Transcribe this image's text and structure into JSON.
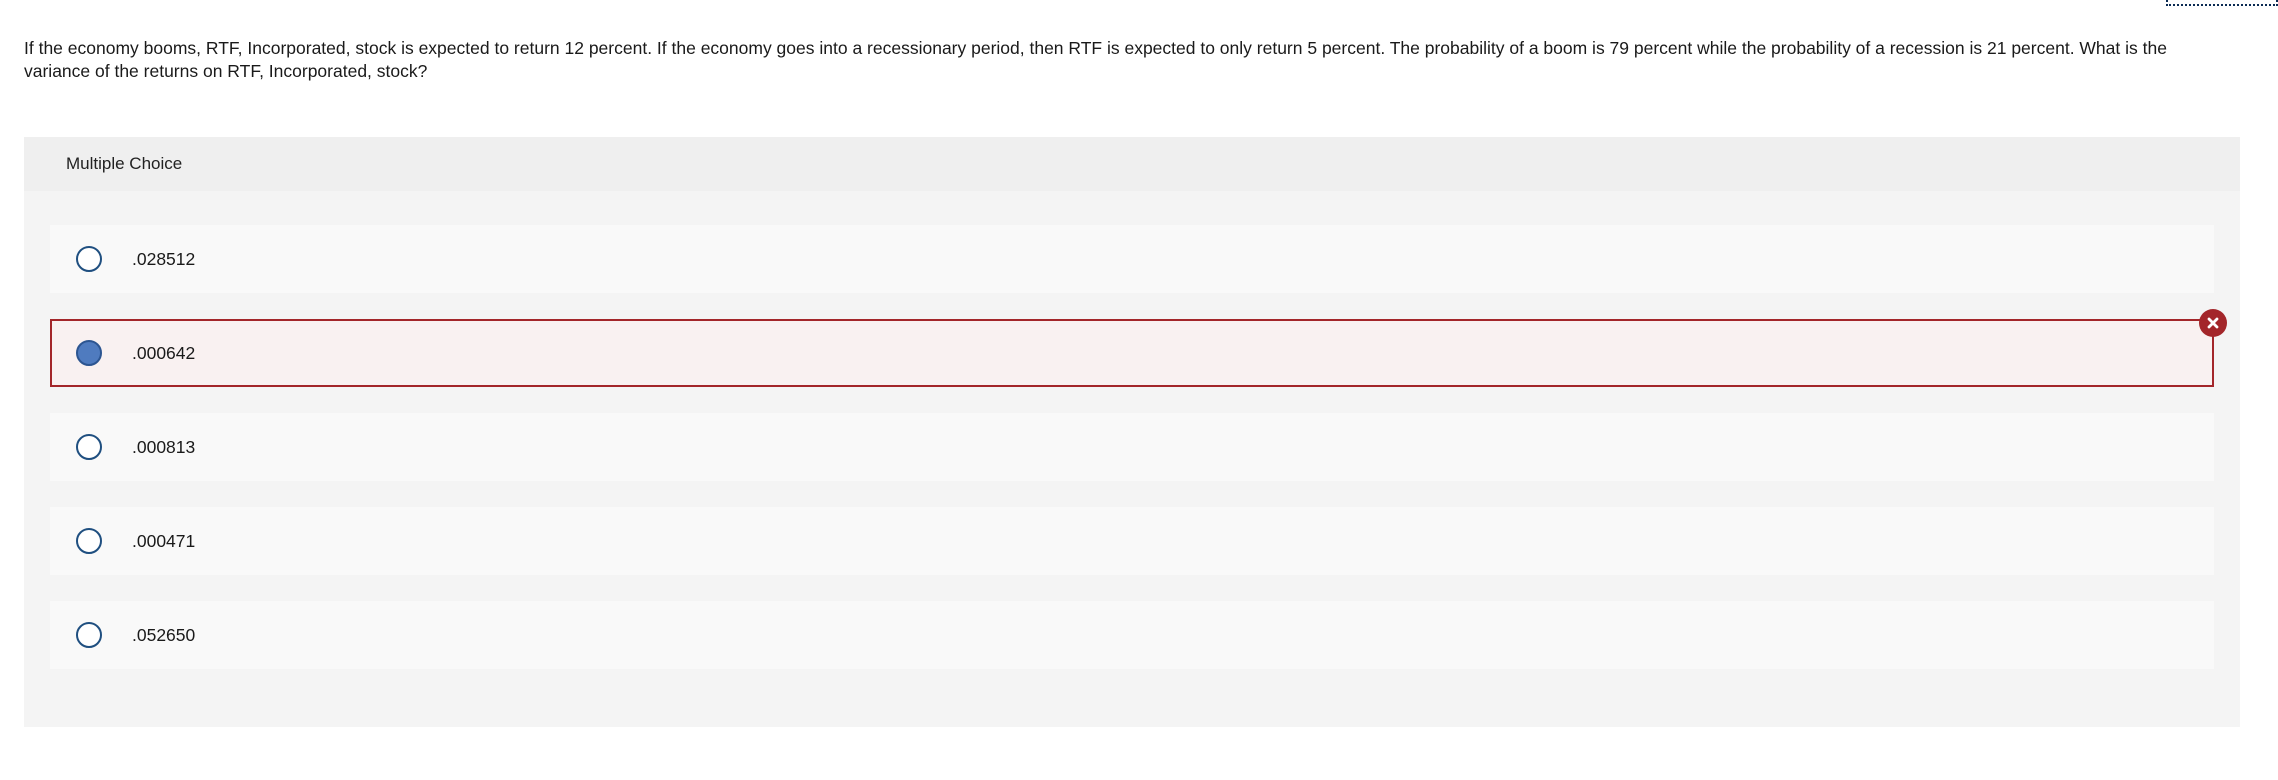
{
  "question": {
    "text": "If the economy booms, RTF, Incorporated, stock is expected to return 12 percent. If the economy goes into a recessionary period, then RTF is expected to only return 5 percent. The probability of a boom is 79 percent while the probability of a recession is 21 percent. What is the variance of the returns on RTF, Incorporated, stock?"
  },
  "panel": {
    "title": "Multiple Choice"
  },
  "options": [
    {
      "label": ".028512",
      "selected": false
    },
    {
      "label": ".000642",
      "selected": true,
      "status": "incorrect"
    },
    {
      "label": ".000813",
      "selected": false
    },
    {
      "label": ".000471",
      "selected": false
    },
    {
      "label": ".052650",
      "selected": false
    }
  ],
  "colors": {
    "incorrect": "#a3262a",
    "radio_border": "#1f4f80",
    "radio_selected_fill": "#4f7bbf",
    "panel_bg": "#f4f4f4",
    "option_bg": "#f9f9f9"
  },
  "icons": {
    "incorrect_badge": "close-x-icon"
  }
}
